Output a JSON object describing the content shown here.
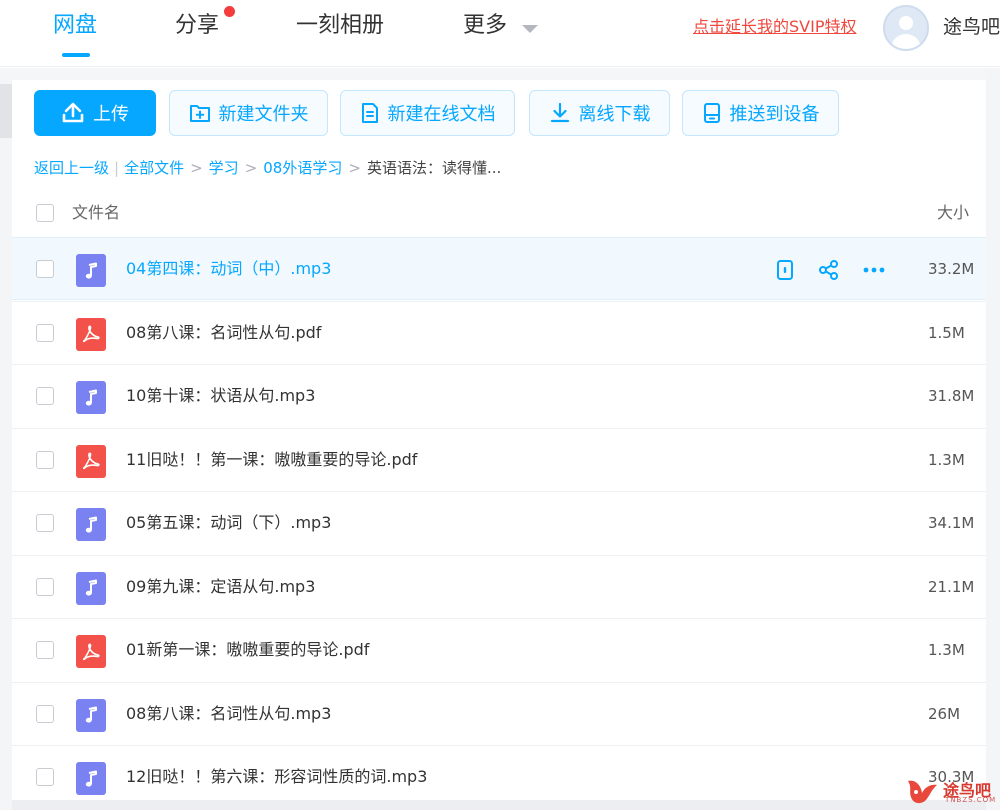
{
  "nav": {
    "items": [
      {
        "label": "网盘",
        "active": true
      },
      {
        "label": "分享",
        "has_dot": true
      },
      {
        "label": "一刻相册"
      },
      {
        "label": "更多",
        "has_caret": true
      }
    ],
    "svip_link": "点击延长我的SVIP特权",
    "username": "途鸟吧"
  },
  "toolbar": {
    "upload": "上传",
    "new_folder": "新建文件夹",
    "new_online_doc": "新建在线文档",
    "offline_download": "离线下载",
    "push_to_device": "推送到设备"
  },
  "breadcrumb": {
    "back": "返回上一级",
    "separator": "|",
    "links": [
      "全部文件",
      "学习",
      "08外语学习"
    ],
    "arrow": ">",
    "current": "英语语法：读得懂..."
  },
  "table": {
    "col_name": "文件名",
    "col_size": "大小",
    "rows": [
      {
        "name": "04第四课：动词（中）.mp3",
        "size": "33.2M",
        "type": "music",
        "hover": true
      },
      {
        "name": "08第八课：名词性从句.pdf",
        "size": "1.5M",
        "type": "pdf"
      },
      {
        "name": "10第十课：状语从句.mp3",
        "size": "31.8M",
        "type": "music"
      },
      {
        "name": "11旧哒！！第一课：嗷嗷重要的导论.pdf",
        "size": "1.3M",
        "type": "pdf"
      },
      {
        "name": "05第五课：动词（下）.mp3",
        "size": "34.1M",
        "type": "music"
      },
      {
        "name": "09第九课：定语从句.mp3",
        "size": "21.1M",
        "type": "music"
      },
      {
        "name": "01新第一课：嗷嗷重要的导论.pdf",
        "size": "1.3M",
        "type": "pdf"
      },
      {
        "name": "08第八课：名词性从句.mp3",
        "size": "26M",
        "type": "music"
      },
      {
        "name": "12旧哒！！第六课：形容词性质的词.mp3",
        "size": "30.3M",
        "type": "music"
      }
    ]
  },
  "row_actions": [
    "push-to-device-icon",
    "share-icon",
    "more-icon"
  ],
  "watermark": {
    "text": "途鸟吧",
    "sub": "TNBZS.COM"
  },
  "colors": {
    "accent": "#06a7ff",
    "music_icon": "#7a81f0",
    "pdf_icon": "#f2524a",
    "svip": "#f0483e"
  }
}
